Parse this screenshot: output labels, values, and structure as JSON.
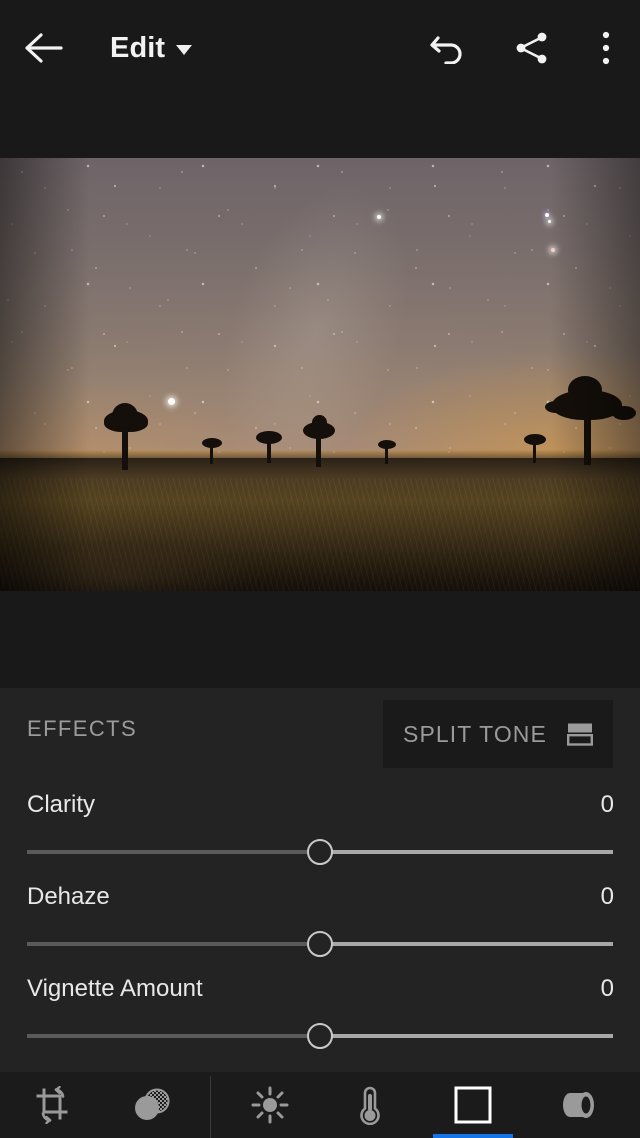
{
  "app": {
    "name": "Lightroom Mobile Edit",
    "accent_color": "#1473E6",
    "panel_bg": "#232323",
    "bar_bg": "#191919",
    "toolbar_bg": "#1b1b1b"
  },
  "topbar": {
    "back_icon": "arrow-left-icon",
    "title": "Edit",
    "title_caret_icon": "chevron-down-icon",
    "undo_icon": "undo-icon",
    "share_icon": "share-icon",
    "more_icon": "more-vertical-icon"
  },
  "photo": {
    "alt": "Night sky over Joshua Tree desert with Milky Way and amber horizon glow"
  },
  "panel": {
    "section_title": "EFFECTS",
    "split_tone": {
      "label": "SPLIT TONE",
      "icon": "split-tone-icon"
    },
    "sliders": [
      {
        "label": "Clarity",
        "value": "0",
        "position_pct": 50
      },
      {
        "label": "Dehaze",
        "value": "0",
        "position_pct": 50
      },
      {
        "label": "Vignette Amount",
        "value": "0",
        "position_pct": 50
      }
    ]
  },
  "toolbar": {
    "items": [
      {
        "name": "crop",
        "icon": "crop-rotate-icon",
        "label": "Crop",
        "selected": false
      },
      {
        "name": "presets",
        "icon": "presets-icon",
        "label": "Presets",
        "selected": false
      },
      {
        "name": "light",
        "icon": "sun-icon",
        "label": "Light",
        "selected": false
      },
      {
        "name": "color",
        "icon": "thermometer-icon",
        "label": "Color",
        "selected": false
      },
      {
        "name": "effects",
        "icon": "vignette-icon",
        "label": "Effects",
        "selected": true
      },
      {
        "name": "optics",
        "icon": "lens-icon",
        "label": "Optics",
        "selected": false
      }
    ]
  }
}
